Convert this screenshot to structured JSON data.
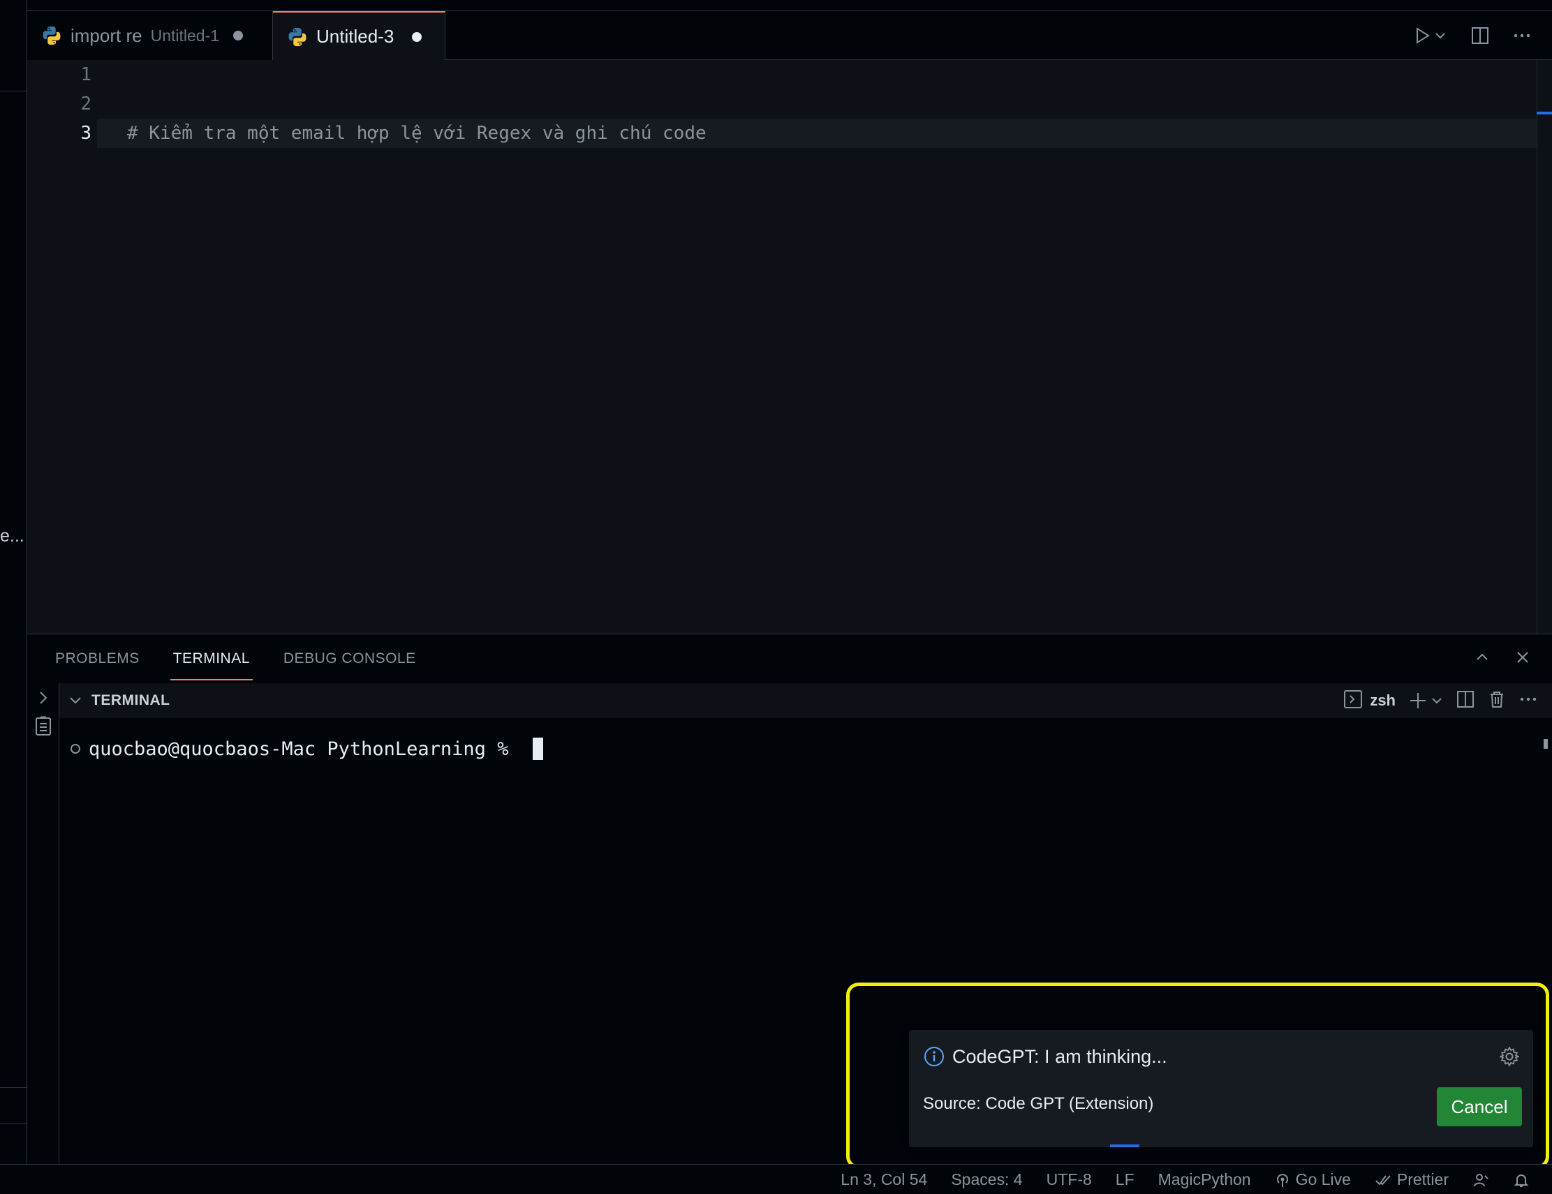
{
  "tabs": [
    {
      "name": "import re",
      "description": "Untitled-1",
      "dirty": true,
      "active": false
    },
    {
      "name": "Untitled-3",
      "description": "",
      "dirty": true,
      "active": true
    }
  ],
  "editor": {
    "line_numbers": [
      "1",
      "2",
      "3"
    ],
    "lines": [
      "",
      "",
      "# Kiểm tra một email hợp lệ với Regex và ghi chú code"
    ],
    "current_line": 3
  },
  "panel": {
    "tabs": [
      "PROBLEMS",
      "TERMINAL",
      "DEBUG CONSOLE"
    ],
    "active_tab": "TERMINAL",
    "section_title": "TERMINAL",
    "shell_name": "zsh",
    "prompt": "quocbao@quocbaos-Mac PythonLearning % "
  },
  "notification": {
    "message": "CodeGPT: I am thinking...",
    "source": "Source: Code GPT (Extension)",
    "cancel_label": "Cancel"
  },
  "status_bar": {
    "position": "Ln 3, Col 54",
    "indent": "Spaces: 4",
    "encoding": "UTF-8",
    "eol": "LF",
    "language": "MagicPython",
    "go_live": "Go Live",
    "prettier": "Prettier"
  },
  "sidebar_fragment": {
    "truncated_text": "e..."
  },
  "colors": {
    "editor_bg": "#0d1117",
    "panel_bg": "#010409",
    "accent_tab": "#f78166",
    "button_green": "#238636",
    "highlight": "#f0f00a",
    "info_blue": "#58a6ff"
  }
}
